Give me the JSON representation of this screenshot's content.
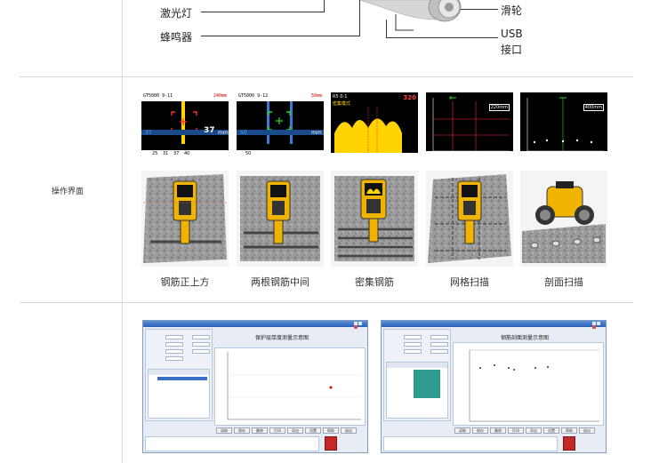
{
  "top_section": {
    "labels": {
      "laser": "激光灯",
      "buzzer": "蜂鸣器",
      "pulley": "滑轮",
      "usb": "USB",
      "usb_port": "接口"
    }
  },
  "interface_section": {
    "label": "操作界面",
    "screens": [
      {
        "header_left": "GT5000 9-11",
        "header_right": "240mm",
        "bottom_left": "37",
        "bottom_unit": "mm",
        "big_value": "37",
        "big_unit": "mm",
        "ticks": [
          "25",
          "31",
          "37",
          "40"
        ],
        "accent": "#ff2a2a"
      },
      {
        "header_left": "GT5000 9-12",
        "header_right": "50mm",
        "bottom_left": "50",
        "bottom_unit": "mm",
        "ticks": [
          "50"
        ],
        "accent": "#22dd22"
      },
      {
        "header_left": "R5 0-1",
        "header_right": "320",
        "mode_label": "密集模式",
        "accent": "#ffd400"
      },
      {
        "header_right": "220mm",
        "accent": "#ff2a2a"
      },
      {
        "header_right": "400mm",
        "accent": "#22dd22"
      }
    ],
    "captions": [
      "钢筋正上方",
      "两根钢筋中间",
      "密集钢筋",
      "网格扫描",
      "剖面扫描"
    ]
  },
  "software_section": {
    "windows": [
      {
        "chart_title": "保护层厚度测量示意图",
        "buttons": [
          "读取",
          "保存",
          "删除",
          "打印",
          "导出",
          "设置",
          "帮助",
          "退出"
        ]
      },
      {
        "chart_title": "钢筋剖面测量示意图",
        "buttons": [
          "读取",
          "保存",
          "删除",
          "打印",
          "导出",
          "设置",
          "帮助",
          "退出"
        ]
      }
    ]
  }
}
